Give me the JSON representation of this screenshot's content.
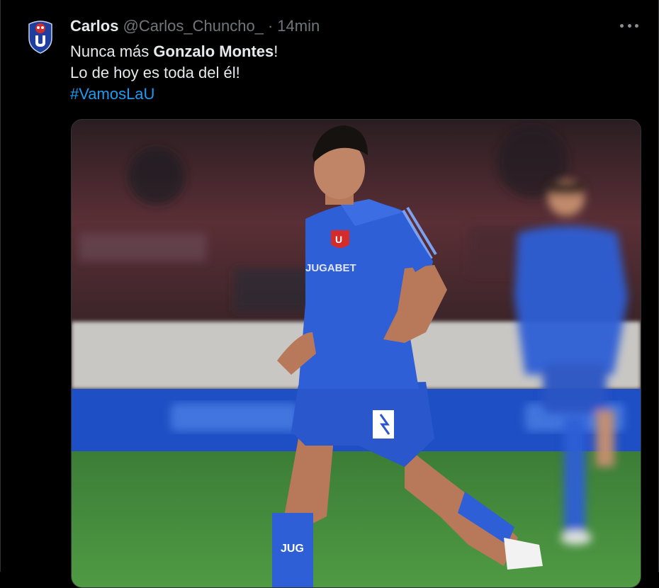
{
  "tweet": {
    "author_name": "Carlos",
    "author_handle": "@Carlos_Chuncho_",
    "separator": "·",
    "time": "14min",
    "text_line1_a": "Nunca más ",
    "text_line1_bold": "Gonzalo Montes",
    "text_line1_b": "!",
    "text_line2": "Lo de hoy es toda del él!",
    "hashtag": "#VamosLaU"
  },
  "media": {
    "icons": [
      "club-crest-icon",
      "more-options-icon"
    ],
    "jersey_sponsor": "JUGABET",
    "jersey_badge": "U",
    "sock_text": "JUG"
  },
  "colors": {
    "background": "#000000",
    "text": "#e7e9ea",
    "secondary": "#71767b",
    "link": "#1d9bf0",
    "jersey_blue": "#2f5fd6",
    "pitch_green": "#3f8a3a"
  }
}
